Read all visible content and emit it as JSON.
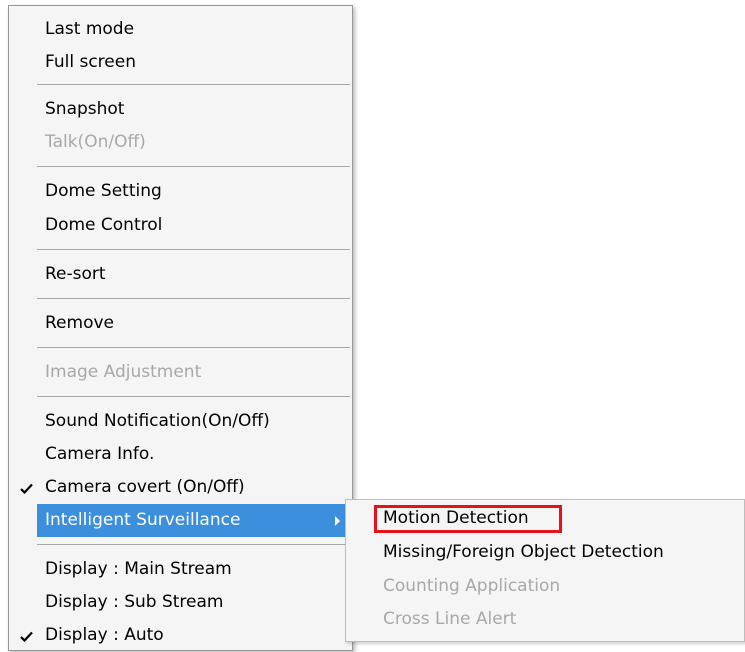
{
  "main_menu": {
    "items": [
      {
        "label": "Last mode",
        "enabled": true,
        "checked": false
      },
      {
        "label": "Full screen",
        "enabled": true,
        "checked": false
      },
      {
        "label": "Snapshot",
        "enabled": true,
        "checked": false
      },
      {
        "label": "Talk(On/Off)",
        "enabled": false,
        "checked": false
      },
      {
        "label": "Dome Setting",
        "enabled": true,
        "checked": false
      },
      {
        "label": "Dome Control",
        "enabled": true,
        "checked": false
      },
      {
        "label": "Re-sort",
        "enabled": true,
        "checked": false
      },
      {
        "label": "Remove",
        "enabled": true,
        "checked": false
      },
      {
        "label": "Image Adjustment",
        "enabled": false,
        "checked": false
      },
      {
        "label": "Sound Notification(On/Off)",
        "enabled": true,
        "checked": false
      },
      {
        "label": "Camera Info.",
        "enabled": true,
        "checked": false
      },
      {
        "label": "Camera covert (On/Off)",
        "enabled": true,
        "checked": true
      },
      {
        "label": "Intelligent Surveillance",
        "enabled": true,
        "checked": false,
        "highlighted": true,
        "has_submenu": true
      },
      {
        "label": "Display : Main Stream",
        "enabled": true,
        "checked": false
      },
      {
        "label": "Display : Sub Stream",
        "enabled": true,
        "checked": false
      },
      {
        "label": "Display : Auto",
        "enabled": true,
        "checked": true
      }
    ]
  },
  "submenu": {
    "items": [
      {
        "label": "Motion Detection",
        "enabled": true,
        "outlined": true
      },
      {
        "label": "Missing/Foreign Object Detection",
        "enabled": true
      },
      {
        "label": "Counting Application",
        "enabled": false
      },
      {
        "label": "Cross Line Alert",
        "enabled": false
      }
    ]
  },
  "colors": {
    "highlight": "#3c8fdd",
    "outline": "#e8111a",
    "disabled_text": "#a8a8a8",
    "menu_bg": "#f5f5f5"
  }
}
